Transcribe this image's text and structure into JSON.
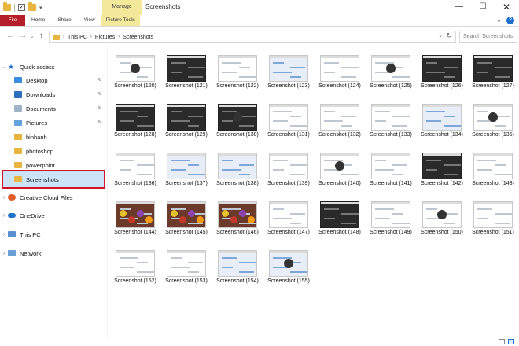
{
  "window": {
    "title": "Screenshots",
    "context_tab": "Manage",
    "controls": {
      "minimize": "—",
      "maximize": "☐",
      "close": "✕"
    }
  },
  "ribbon": {
    "tabs": [
      "File",
      "Home",
      "Share",
      "View",
      "Picture Tools"
    ],
    "help": "?"
  },
  "address": {
    "breadcrumb": [
      "This PC",
      "Pictures",
      "Screenshots"
    ],
    "search_placeholder": "Search Screenshots"
  },
  "nav": {
    "quick_access": "Quick access",
    "items": [
      "Desktop",
      "Downloads",
      "Documents",
      "Pictures",
      "hinhanh",
      "photoshop",
      "powerpoint",
      "Screenshots"
    ],
    "roots": [
      "Creative Cloud Files",
      "OneDrive",
      "This PC",
      "Network"
    ]
  },
  "files": [
    "Screenshot (120)",
    "Screenshot (121)",
    "Screenshot (122)",
    "Screenshot (123)",
    "Screenshot (124)",
    "Screenshot (125)",
    "Screenshot (126)",
    "Screenshot (127)",
    "Screenshot (128)",
    "Screenshot (129)",
    "Screenshot (130)",
    "Screenshot (131)",
    "Screenshot (132)",
    "Screenshot (133)",
    "Screenshot (134)",
    "Screenshot (135)",
    "Screenshot (136)",
    "Screenshot (137)",
    "Screenshot (138)",
    "Screenshot (139)",
    "Screenshot (140)",
    "Screenshot (141)",
    "Screenshot (142)",
    "Screenshot (143)",
    "Screenshot (144)",
    "Screenshot (145)",
    "Screenshot (146)",
    "Screenshot (147)",
    "Screenshot (148)",
    "Screenshot (149)",
    "Screenshot (150)",
    "Screenshot (151)",
    "Screenshot (152)",
    "Screenshot (153)",
    "Screenshot (154)",
    "Screenshot (155)"
  ],
  "colors": {
    "file_tab": "#b51f2a",
    "context_tab": "#f4e89b",
    "selection": "#cce4f7",
    "highlight_border": "#d2142a"
  }
}
